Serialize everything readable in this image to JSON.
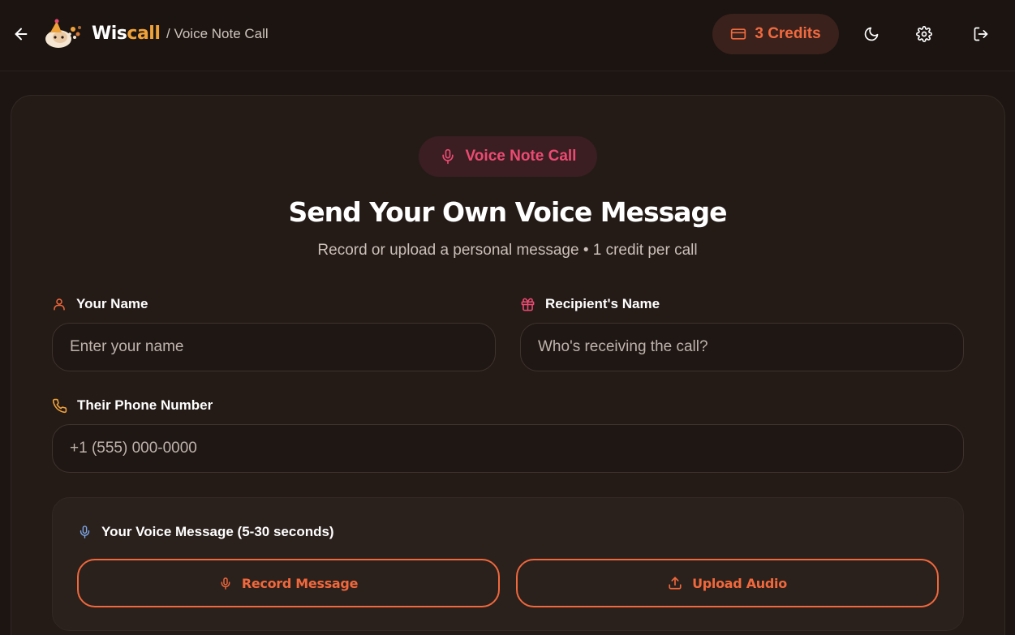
{
  "header": {
    "brand_part1": "Wis",
    "brand_part2": "call",
    "breadcrumb": "/ Voice Note Call",
    "credits_label": "3 Credits",
    "icons": {
      "back": "arrow-left-icon",
      "credits": "credit-card-icon",
      "theme": "moon-icon",
      "settings": "gear-icon",
      "logout": "logout-icon"
    }
  },
  "main": {
    "mode_pill_label": "Voice Note Call",
    "title": "Send Your Own Voice Message",
    "subtitle": "Record or upload a personal message • 1 credit per call",
    "fields": {
      "your_name": {
        "label": "Your Name",
        "placeholder": "Enter your name",
        "value": ""
      },
      "recipient_name": {
        "label": "Recipient's Name",
        "placeholder": "Who's receiving the call?",
        "value": ""
      },
      "phone": {
        "label": "Their Phone Number",
        "placeholder": "+1 (555) 000-0000",
        "value": ""
      }
    },
    "voice": {
      "label": "Your Voice Message (5-30 seconds)",
      "record_label": "Record Message",
      "upload_label": "Upload Audio"
    }
  },
  "colors": {
    "accent_orange": "#f0683c",
    "accent_pink": "#ec4a72",
    "brand_yellow": "#f0a23a",
    "background": "#1c1512",
    "card": "#241b17"
  }
}
